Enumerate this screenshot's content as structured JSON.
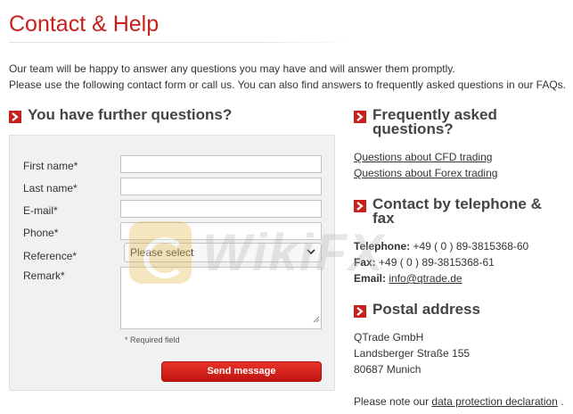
{
  "page": {
    "title": "Contact & Help",
    "intro_line1": "Our team will be happy to answer any questions you may have and will answer them promptly.",
    "intro_line2": "Please use the following contact form or call us. You can also find answers to frequently asked questions in our FAQs."
  },
  "form": {
    "heading": "You have further questions?",
    "first_name_label": "First name*",
    "last_name_label": "Last name*",
    "email_label": "E-mail*",
    "phone_label": "Phone*",
    "reference_label": "Reference*",
    "reference_selected": "Please select",
    "remark_label": "Remark*",
    "required_note": "* Required field",
    "send_label": "Send message"
  },
  "faq": {
    "heading_line1": "Frequently asked",
    "heading_line2": "questions?",
    "link_cfd": "Questions about CFD trading",
    "link_forex": "Questions about Forex trading"
  },
  "phone": {
    "heading_line1": "Contact by telephone &",
    "heading_line2": "fax",
    "telephone_label": "Telephone:",
    "telephone_value": "+49 ( 0 ) 89-3815368-60",
    "fax_label": "Fax:",
    "fax_value": "+49 ( 0 ) 89-3815368-61",
    "email_label": "Email:",
    "email_value": "info@qtrade.de"
  },
  "postal": {
    "heading": "Postal address",
    "line1": "QTrade GmbH",
    "line2": "Landsberger Straße 155",
    "line3": "80687 Munich"
  },
  "footer": {
    "note_prefix": "Please note our",
    "link": "data protection declaration",
    "suffix": "."
  },
  "watermark": {
    "text": "WikiFX"
  },
  "colors": {
    "accent": "#c8201c",
    "heading": "#444444",
    "panel": "#f1f1f1"
  }
}
